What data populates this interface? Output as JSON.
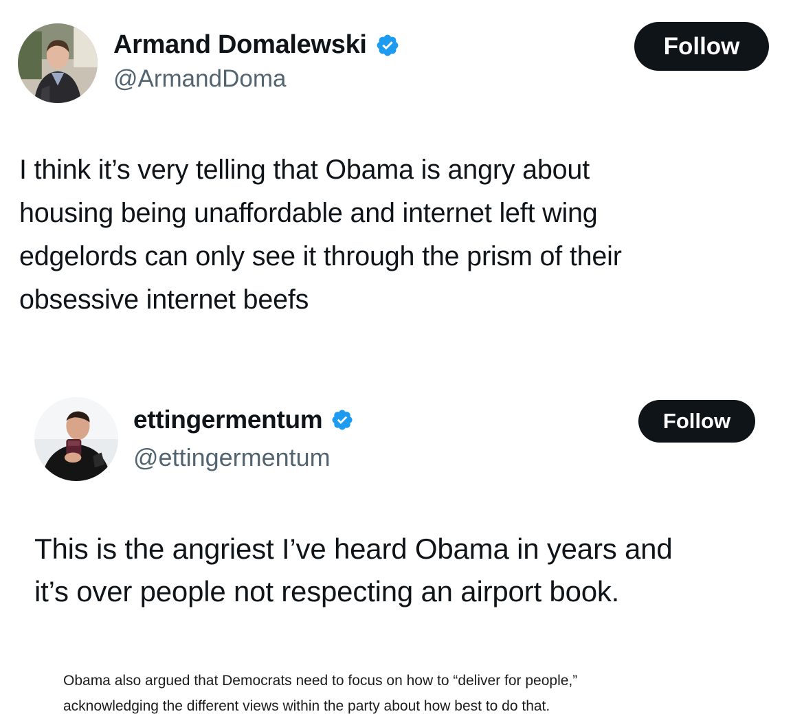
{
  "outer_tweet": {
    "author": {
      "display_name": "Armand Domalewski",
      "handle": "@ArmandDoma",
      "verified": true,
      "avatar_icon": "person-portrait-avatar"
    },
    "follow_label": "Follow",
    "text_lines": [
      "I think it’s very telling that Obama is angry about",
      "housing being unaffordable and internet left wing",
      "edgelords can only see it through the prism of their",
      "obsessive internet beefs"
    ]
  },
  "quoted_tweet": {
    "author": {
      "display_name": "ettingermentum",
      "handle": "@ettingermentum",
      "verified": true,
      "avatar_icon": "person-with-mug-avatar"
    },
    "follow_label": "Follow",
    "text_lines": [
      "This is the angriest I’ve heard Obama in years and",
      "it’s over people not respecting an airport book."
    ],
    "article_snippet_lines": [
      "Obama also argued that Democrats need to focus on how to “deliver for people,”",
      "acknowledging the different views within the party about how best to do that."
    ]
  },
  "colors": {
    "text_primary": "#0f1419",
    "text_secondary": "#536471",
    "button_bg": "#0f1419",
    "button_text": "#ffffff",
    "verified_badge": "#1d9bf0"
  }
}
